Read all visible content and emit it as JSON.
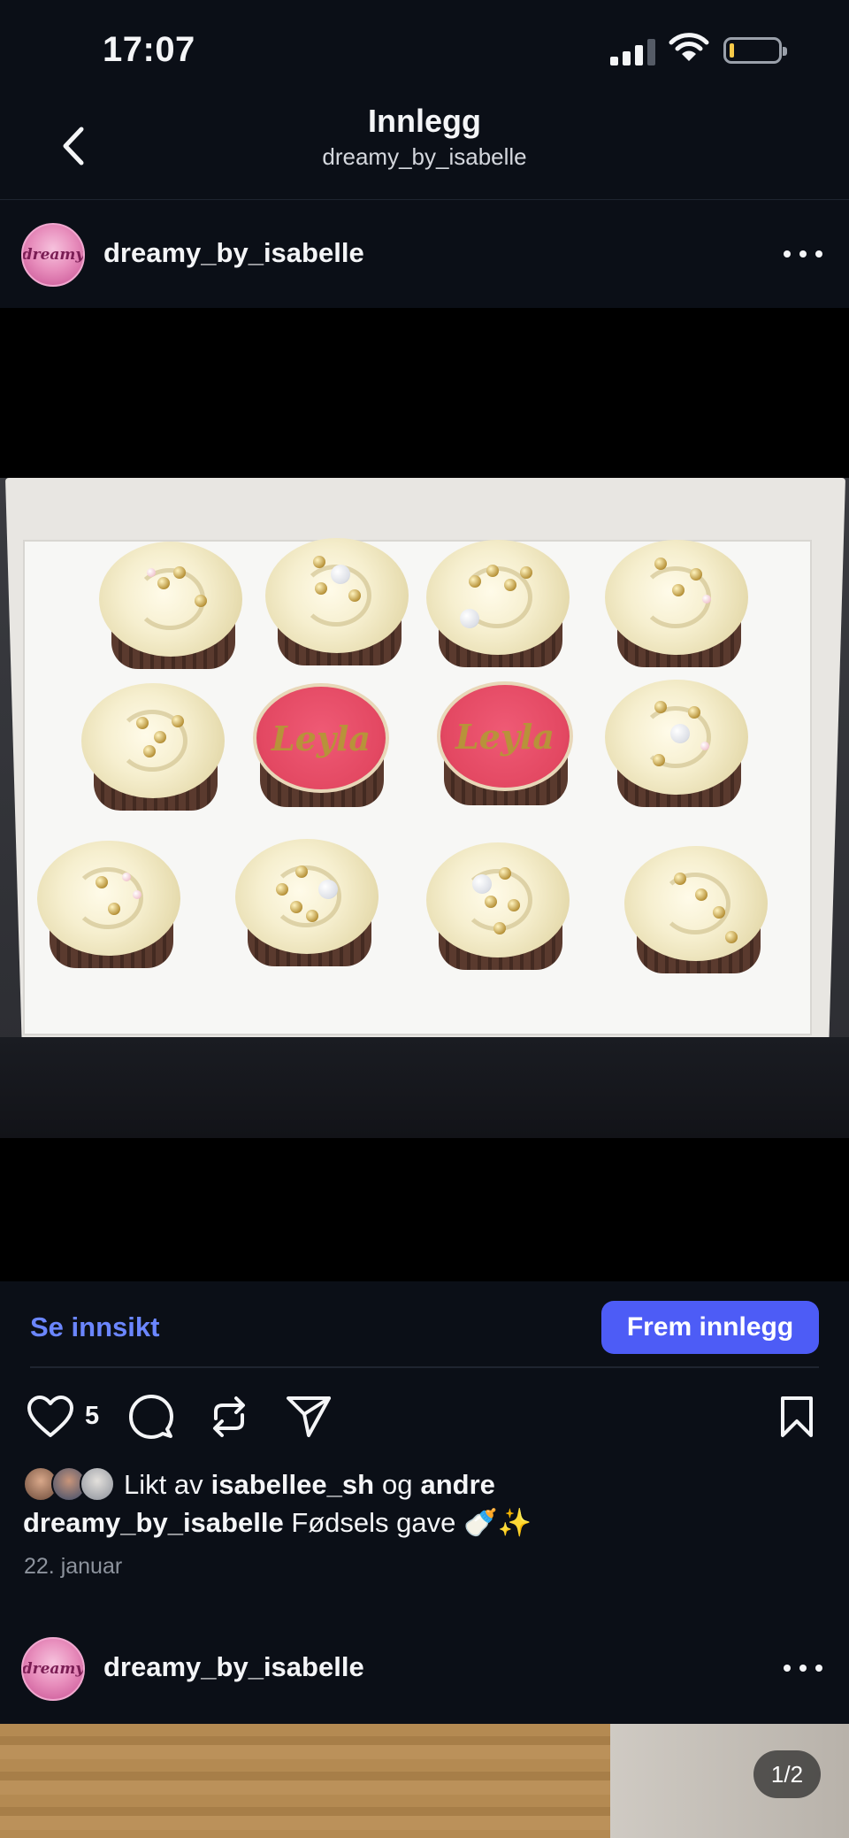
{
  "status_bar": {
    "time": "17:07"
  },
  "nav": {
    "title": "Innlegg",
    "subtitle": "dreamy_by_isabelle"
  },
  "post": {
    "username": "dreamy_by_isabelle",
    "avatar_text": "dreamy",
    "topper_text": "Leyla",
    "insights_label": "Se innsikt",
    "promote_label": "Frem innlegg",
    "like_count": "5",
    "liked_by_prefix": "Likt av",
    "liked_by_user": "isabellee_sh",
    "liked_by_and": "og",
    "liked_by_others": "andre",
    "caption_user": "dreamy_by_isabelle",
    "caption_text": "Fødsels gave 🍼✨",
    "date": "22. januar"
  },
  "next_post": {
    "username": "dreamy_by_isabelle",
    "avatar_text": "dreamy",
    "pager": "1/2"
  },
  "icons": {
    "back": "chevron-left-icon",
    "more": "more-horizontal-icon",
    "like": "heart-icon",
    "comment": "comment-icon",
    "repost": "repost-icon",
    "share": "send-icon",
    "save": "bookmark-icon"
  },
  "colors": {
    "background": "#0b0f17",
    "accent_link": "#6b86ff",
    "promote_button": "#4d5cf6",
    "muted_text": "#8d939d"
  }
}
